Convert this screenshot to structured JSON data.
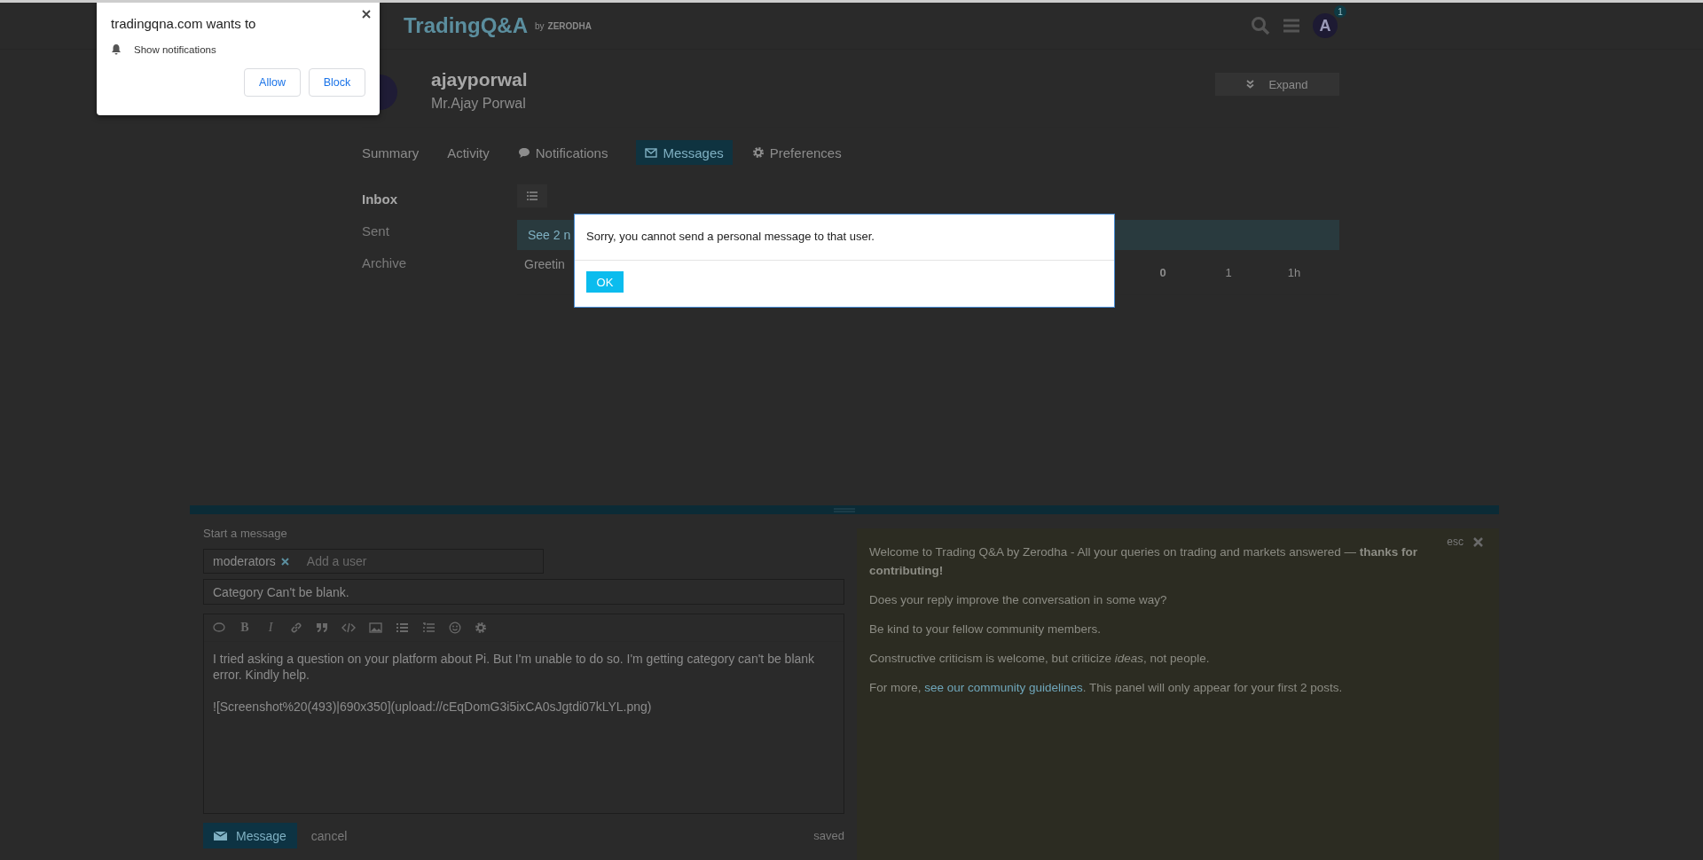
{
  "notification_prompt": {
    "title": "tradingqna.com wants to",
    "permission": "Show notifications",
    "buttons": [
      {
        "label": "Allow"
      },
      {
        "label": "Block"
      }
    ]
  },
  "header": {
    "logo": "TradingQ&A",
    "logo_by": "by",
    "logo_brand": "ZERODHA",
    "avatar_letter": "A",
    "notification_count": "1"
  },
  "profile": {
    "username": "ajayporwal",
    "full_name": "Mr.Ajay Porwal",
    "expand_button": "Expand"
  },
  "tabs": [
    {
      "label": "Summary",
      "selected": false,
      "kind": "text"
    },
    {
      "label": "Activity",
      "selected": false,
      "kind": "text"
    },
    {
      "label": "Notifications",
      "selected": false,
      "kind": "icon"
    },
    {
      "label": "Messages",
      "selected": true,
      "kind": "icon"
    },
    {
      "label": "Preferences",
      "selected": false,
      "kind": "icon"
    }
  ],
  "sidebar": {
    "items": [
      {
        "label": "Inbox",
        "selected": true
      },
      {
        "label": "Sent",
        "selected": false
      },
      {
        "label": "Archive",
        "selected": false
      }
    ]
  },
  "message_list": {
    "banner": "See 2 n",
    "rows": [
      {
        "title": "Greetin",
        "cells": [
          "0",
          "1",
          "1h"
        ]
      }
    ]
  },
  "dialog": {
    "message": "Sorry, you cannot send a personal message to that user.",
    "button": "OK"
  },
  "composer": {
    "title": "Start a message",
    "recipients": [
      {
        "name": "moderators"
      }
    ],
    "recipient_placeholder": "Add a user",
    "category": "Category Can't be blank.",
    "toolbar": [
      {
        "kind": "icon"
      },
      {
        "kind": "text",
        "label": "B"
      },
      {
        "kind": "text",
        "label": "I"
      },
      {
        "kind": "icon"
      },
      {
        "kind": "icon"
      },
      {
        "kind": "icon"
      },
      {
        "kind": "icon"
      },
      {
        "kind": "icon"
      },
      {
        "kind": "icon"
      },
      {
        "kind": "icon"
      },
      {
        "kind": "icon"
      }
    ],
    "body": [
      "I tried asking a question on your platform about Pi. But I'm unable to do so. I'm getting category can't be blank error. Kindly help.",
      "![Screenshot%20(493)|690x350](upload://cEqDomG3i5ixCA0sJgtdi07kLYL.png)"
    ],
    "submit": "Message",
    "cancel": "cancel",
    "status": "saved"
  },
  "education_panel": {
    "esc": "esc",
    "paragraphs": [
      "Welcome to Trading Q&A by Zerodha - All your queries on trading and markets answered — **thanks for contributing!**",
      "Does your reply improve the conversation in some way?",
      "Be kind to your fellow community members.",
      "Constructive criticism is welcome, but criticize *ideas*, not people."
    ],
    "footer": {
      "text": "For more, ",
      "link": "see our community guidelines",
      "after": ". This panel will only appear for your first 2 posts."
    }
  }
}
